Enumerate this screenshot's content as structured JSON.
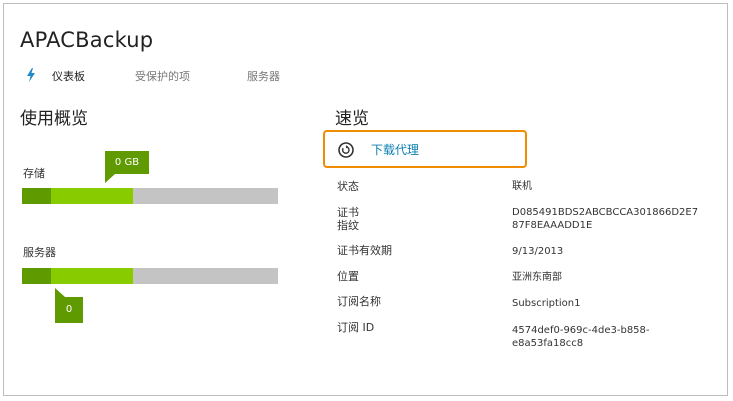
{
  "app": {
    "title": "APACBackup"
  },
  "tabs": [
    {
      "label": "仪表板",
      "icon": "lightning-bolt-icon",
      "active": true
    },
    {
      "label": "受保护的项",
      "active": false
    },
    {
      "label": "服务器",
      "active": false
    }
  ],
  "overview": {
    "title": "使用概览",
    "storage": {
      "label": "存储",
      "callout": "0 GB"
    },
    "servers": {
      "label": "服务器",
      "callout": "0"
    }
  },
  "quick_glance": {
    "title": "速览",
    "download": {
      "label": "下载代理",
      "icon": "download-circle-icon"
    },
    "rows": [
      {
        "key": "状态",
        "value": "联机"
      },
      {
        "key": "证书\n指纹",
        "value": "D085491BDS2ABCBCCA301866D2E7\n87F8EAAADD1E"
      },
      {
        "key": "证书有效期",
        "value": "9/13/2013"
      },
      {
        "key": "位置",
        "value": "亚洲东南部"
      },
      {
        "key": "订阅名称",
        "value": "Subscription1"
      },
      {
        "key": "订阅 ID",
        "value": "4574def0-969c-4de3-b858-\ne8a53fa18cc8"
      }
    ]
  },
  "colors": {
    "accent": "#0a7fb2",
    "highlight_border": "#f08c00",
    "bar_dark": "#5f9a00",
    "bar_light": "#88cc00",
    "bar_empty": "#c4c4c4"
  }
}
